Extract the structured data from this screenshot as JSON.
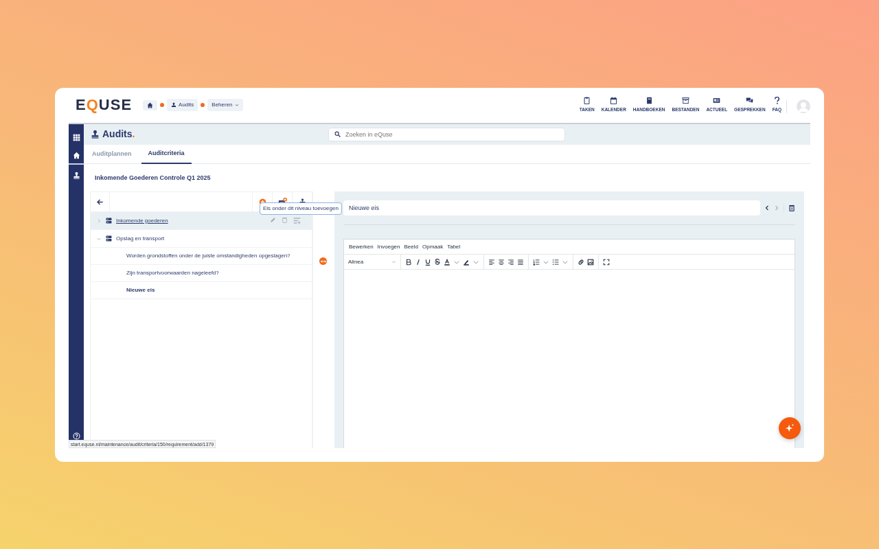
{
  "header": {
    "logo": "EQUSE",
    "breadcrumbs": [
      {
        "kind": "home"
      },
      {
        "kind": "link",
        "label": "Audits"
      },
      {
        "kind": "dropdown",
        "label": "Beheren"
      }
    ],
    "nav": [
      {
        "kind": "clipboard",
        "label": "TAKEN"
      },
      {
        "kind": "calendar",
        "label": "KALENDER"
      },
      {
        "kind": "book",
        "label": "HANDBOEKEN"
      },
      {
        "kind": "archive",
        "label": "BESTANDEN"
      },
      {
        "kind": "news",
        "label": "ACTUEEL"
      },
      {
        "kind": "chat",
        "label": "GESPREKKEN"
      },
      {
        "kind": "question",
        "label": "FAQ"
      }
    ]
  },
  "sidebar": {
    "items": [
      {
        "kind": "apps",
        "selected": false
      },
      {
        "kind": "home",
        "selected": true
      },
      {
        "kind": "stamp",
        "selected": false
      }
    ]
  },
  "page": {
    "title": "Audits",
    "accent": ".",
    "search": {
      "placeholder": "Zoeken in eQuse"
    }
  },
  "tabs": [
    {
      "label": "Auditplannen",
      "selected": false
    },
    {
      "label": "Auditcriteria",
      "selected": true
    }
  ],
  "heading": "Inkomende Goederen Controle Q1 2025",
  "tree": {
    "tooltip": "Eis onder dit niveau toevoegen",
    "items": [
      {
        "label": "Inkomende goederen",
        "expanded": false,
        "hovered": true,
        "selected": false
      },
      {
        "label": "Opslag en transport",
        "expanded": true,
        "hovered": false,
        "selected": false,
        "children": [
          {
            "label": "Worden grondstoffen onder de juiste omstandigheden opgeslagen?",
            "selected": false
          },
          {
            "label": "Zijn transportvoorwaarden nageleefd?",
            "selected": false
          },
          {
            "label": "Nieuwe eis",
            "selected": true
          }
        ]
      }
    ]
  },
  "editor": {
    "title": "Nieuwe eis",
    "menu": [
      "Bewerken",
      "Invoegen",
      "Beeld",
      "Opmaak",
      "Tabel"
    ],
    "block_format": "Alinea"
  },
  "status_url": "start.equse.nl/maintenance/audit/criteria/150/requirement/add/1379"
}
